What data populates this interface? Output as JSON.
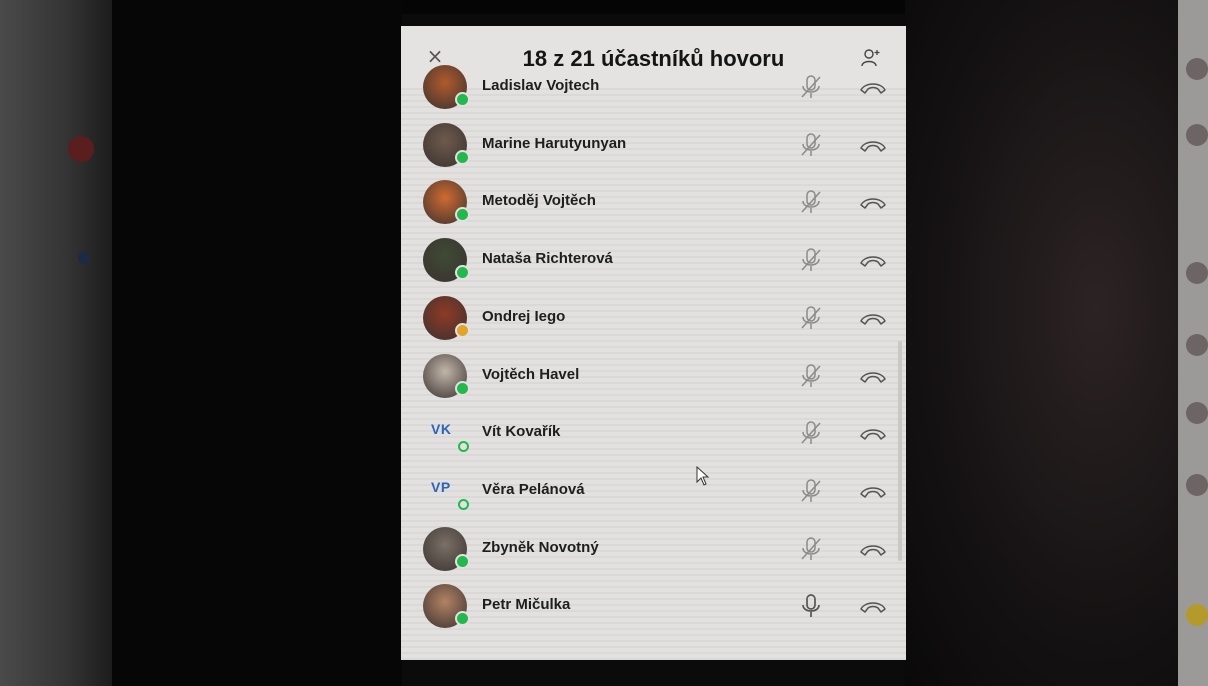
{
  "window": {
    "title": "18 z 21 účastníků hovoru",
    "close_icon": "close-icon",
    "add_icon": "add-person-icon"
  },
  "participants": [
    {
      "name": "Ladislav Vojtech",
      "avatar_color": "#b05a2c",
      "status": "online",
      "mic": "muted"
    },
    {
      "name": "Marine Harutyunyan",
      "avatar_color": "#6e5a4c",
      "status": "online",
      "mic": "muted"
    },
    {
      "name": "Metoděj Vojtěch",
      "avatar_color": "#d06a30",
      "status": "online",
      "mic": "muted"
    },
    {
      "name": "Nataša Richterová",
      "avatar_color": "#3f4a34",
      "status": "online",
      "mic": "muted"
    },
    {
      "name": "Ondrej Iego",
      "avatar_color": "#8e3a26",
      "status": "away",
      "mic": "muted"
    },
    {
      "name": "Vojtěch Havel",
      "avatar_color": "#c2b6aa",
      "status": "online",
      "mic": "muted"
    },
    {
      "name": "Vít Kovařík",
      "initials": "VK",
      "status": "ring",
      "mic": "muted"
    },
    {
      "name": "Věra Pelánová",
      "initials": "VP",
      "status": "ring",
      "mic": "muted"
    },
    {
      "name": "Zbyněk Novotný",
      "avatar_color": "#7a7066",
      "status": "online",
      "mic": "muted"
    },
    {
      "name": "Petr Mičulka",
      "avatar_color": "#b38264",
      "status": "online",
      "mic": "on"
    }
  ],
  "colors": {
    "accent": "#2d63b8",
    "online": "#23b84e",
    "away": "#e0a52a"
  }
}
